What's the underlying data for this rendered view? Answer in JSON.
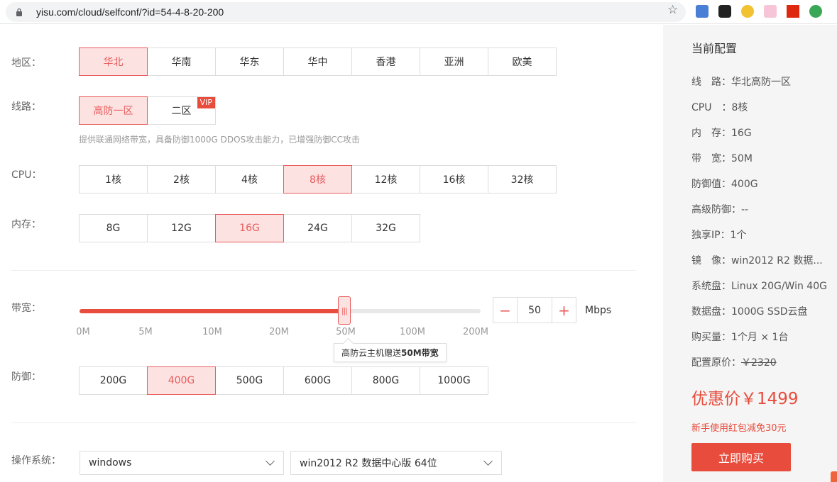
{
  "browser": {
    "url": "yisu.com/cloud/selfconf/?id=54-4-8-20-200"
  },
  "region": {
    "label": "地区：",
    "options": [
      "华北",
      "华南",
      "华东",
      "华中",
      "香港",
      "亚洲",
      "欧美"
    ],
    "selected": "华北"
  },
  "line": {
    "label": "线路：",
    "options": [
      "高防一区",
      "二区"
    ],
    "selected": "高防一区",
    "vip_badge": "VIP",
    "note": "提供联通网络带宽，具备防御1000G DDOS攻击能力，已增强防御CC攻击"
  },
  "cpu": {
    "label": "CPU：",
    "options": [
      "1核",
      "2核",
      "4核",
      "8核",
      "12核",
      "16核",
      "32核"
    ],
    "selected": "8核"
  },
  "memory": {
    "label": "内存：",
    "options": [
      "8G",
      "12G",
      "16G",
      "24G",
      "32G"
    ],
    "selected": "16G"
  },
  "bandwidth": {
    "label": "带宽：",
    "ticks": [
      "0M",
      "5M",
      "10M",
      "20M",
      "50M",
      "100M",
      "200M"
    ],
    "value": "50",
    "slider_fraction": 0.66,
    "unit": "Mbps",
    "tooltip_prefix": "高防云主机赠送",
    "tooltip_bold": "50M带宽",
    "minus": "−",
    "plus": "+"
  },
  "defense": {
    "label": "防御：",
    "options": [
      "200G",
      "400G",
      "500G",
      "600G",
      "800G",
      "1000G"
    ],
    "selected": "400G"
  },
  "os": {
    "label": "操作系统：",
    "type_value": "windows",
    "version_value": "win2012 R2 数据中心版 64位"
  },
  "summary": {
    "title": "当前配置",
    "rows": [
      {
        "key": "线　路：",
        "value": "华北高防一区"
      },
      {
        "key": "CPU　：",
        "value": "8核"
      },
      {
        "key": "内　存：",
        "value": "16G"
      },
      {
        "key": "带　宽：",
        "value": "50M"
      },
      {
        "key": "防御值：",
        "value": "400G"
      },
      {
        "key": "高级防御：",
        "value": "--"
      },
      {
        "key": "独享IP：",
        "value": "1个"
      },
      {
        "key": "镜　像：",
        "value": "win2012 R2 数据..."
      },
      {
        "key": "系统盘：",
        "value": "Linux 20G/Win 40G"
      },
      {
        "key": "数据盘：",
        "value": "1000G SSD云盘"
      },
      {
        "key": "购买量：",
        "value": "1个月 × 1台"
      }
    ],
    "original_label": "配置原价：",
    "original_price": "￥2320",
    "sale_label": "优惠价",
    "sale_price": "￥1499",
    "promo": "新手使用红包减免30元",
    "buy_label": "立即购买"
  },
  "colors": {
    "accent": "#e74c3c",
    "active_bg": "#fde2e2"
  }
}
